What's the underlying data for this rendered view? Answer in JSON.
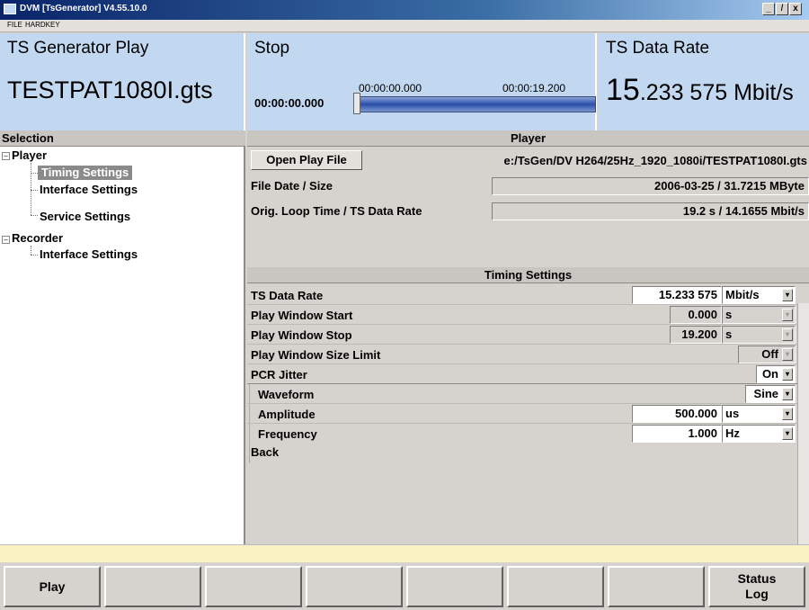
{
  "window": {
    "title": "DVM [TsGenerator]  V4.55.10.0",
    "min": "_",
    "max": "̸",
    "close": "x"
  },
  "menu": {
    "file": "FILE",
    "hardkey": "HARDKEY"
  },
  "header": {
    "panel1": {
      "caption": "TS Generator Play",
      "value": "TESTPAT1080I.gts"
    },
    "panel2": {
      "caption": "Stop",
      "time_current": "00:00:00.000",
      "time_start": "00:00:00.000",
      "time_end": "00:00:19.200",
      "progress": 0.0
    },
    "panel3": {
      "caption": "TS Data Rate",
      "value_main": "15",
      "value_rest": ".233 575 Mbit/s"
    }
  },
  "selection": {
    "header": "Selection",
    "tree": [
      {
        "label": "Player",
        "expander": "–"
      },
      {
        "label": "Timing Settings"
      },
      {
        "label": "Interface Settings"
      },
      {
        "label": "Service Settings"
      },
      {
        "label": "Recorder",
        "expander": "–"
      },
      {
        "label": "Interface Settings"
      }
    ]
  },
  "player": {
    "header": "Player",
    "open_button": "Open Play File",
    "file_path": "e:/TsGen/DV H264/25Hz_1920_1080i/TESTPAT1080I.gts",
    "file_date_label": "File Date / Size",
    "file_date_value": "2006-03-25 / 31.7215 MByte",
    "loop_label": "Orig. Loop Time / TS Data Rate",
    "loop_value": "19.2 s / 14.1655 Mbit/s"
  },
  "timing": {
    "header": "Timing Settings",
    "rows": [
      {
        "label": "TS Data Rate",
        "value": "15.233 575",
        "unit": "Mbit/s"
      },
      {
        "label": "Play Window Start",
        "value": "0.000",
        "unit": "s"
      },
      {
        "label": "Play Window Stop",
        "value": "19.200",
        "unit": "s"
      },
      {
        "label": "Play Window Size Limit",
        "value": "Off"
      },
      {
        "label": "PCR Jitter",
        "value": "On"
      },
      {
        "label": "Waveform",
        "value": "Sine"
      },
      {
        "label": "Amplitude",
        "value": "500.000",
        "unit": "us"
      },
      {
        "label": "Frequency",
        "value": "1.000",
        "unit": "Hz"
      }
    ],
    "back": "Back"
  },
  "fkeys": [
    "Play",
    "",
    "",
    "",
    "",
    "",
    "",
    "Status Log"
  ],
  "dropdown_arrow": "▾"
}
